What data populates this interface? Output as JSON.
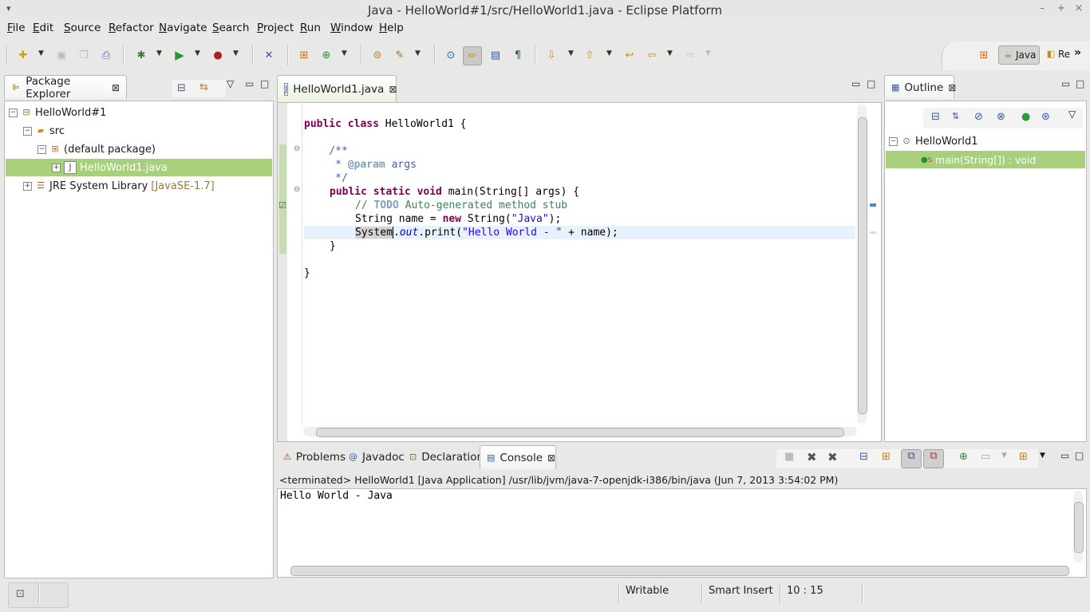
{
  "window": {
    "title": "Java - HelloWorld#1/src/HelloWorld1.java - Eclipse Platform",
    "sys_menu": "▾",
    "min": "–",
    "max": "+",
    "close": "×"
  },
  "menu": [
    "File",
    "Edit",
    "Source",
    "Refactor",
    "Navigate",
    "Search",
    "Project",
    "Run",
    "Window",
    "Help"
  ],
  "perspectives": {
    "java_label": "Java",
    "other_label": "Re",
    "overflow": "»"
  },
  "package_explorer": {
    "title": "Package Explorer",
    "tree": [
      {
        "label": "HelloWorld#1",
        "icon": "project-icon"
      },
      {
        "label": "src",
        "icon": "source-folder-icon"
      },
      {
        "label": "(default package)",
        "icon": "package-icon"
      },
      {
        "label": "HelloWorld1.java",
        "icon": "java-file-icon",
        "selected": true
      },
      {
        "label": "JRE System Library",
        "suffix": "[JavaSE-1.7]",
        "icon": "library-icon"
      }
    ],
    "expanders": [
      "−",
      "−",
      "−",
      "+",
      "+"
    ]
  },
  "editor": {
    "tab_label": "HelloWorld1.java",
    "lines": {
      "l1_kw": "public class",
      "l1_rest": " HelloWorld1 {",
      "l3": "    /**",
      "l4_star": "     * ",
      "l4_tag": "@param",
      "l4_rest": " args",
      "l5": "     */",
      "l6_kw1": "public static void",
      "l6_rest": " main(String[] args) {",
      "l7_comment": "// ",
      "l7_todo": "TODO",
      "l7_rest": " Auto-generated method stub",
      "l8_pre": "String name = ",
      "l8_kw": "new",
      "l8_mid": " String(",
      "l8_str": "\"Java\"",
      "l8_end": ");",
      "l9_sys": "System",
      "l9_dot": ".",
      "l9_out": "out",
      "l9_mid": ".print(",
      "l9_str": "\"Hello World - \"",
      "l9_end": " + name);",
      "l10": "}",
      "l12": "}"
    }
  },
  "outline": {
    "title": "Outline",
    "class_name": "HelloWorld1",
    "method": "main(String[]) : void",
    "static_marker": "S",
    "expander": "−"
  },
  "bottom": {
    "tabs": [
      {
        "label": "Problems"
      },
      {
        "label": "Javadoc"
      },
      {
        "label": "Declaration"
      },
      {
        "label": "Console",
        "active": true
      }
    ],
    "console_header": "<terminated> HelloWorld1 [Java Application] /usr/lib/jvm/java-7-openjdk-i386/bin/java (Jun 7, 2013 3:54:02 PM)",
    "console_output": "Hello World - Java"
  },
  "status": {
    "writable": "Writable",
    "insert_mode": "Smart Insert",
    "position": "10 : 15"
  },
  "colors": {
    "selection": "#a7cf7c",
    "keyword": "#7f0055",
    "string": "#2a00ff",
    "comment": "#3f7f5f",
    "javadoc": "#3f5fbf"
  }
}
